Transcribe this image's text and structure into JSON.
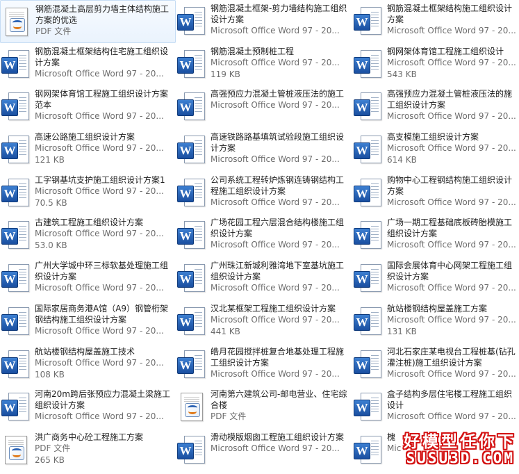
{
  "files": [
    {
      "name": "钢筋混凝土高层剪力墙主体结构施工方案的优选",
      "type": "pdf",
      "meta": [
        "PDF 文件"
      ],
      "selected": true
    },
    {
      "name": "钢筋混凝土框架-剪力墙结构施工组织设计方案",
      "type": "word",
      "meta": [
        "Microsoft Office Word 97 - 20..."
      ]
    },
    {
      "name": "钢筋混凝土框架结构施工组织设计方案",
      "type": "word",
      "meta": [
        "Microsoft Office Word 97 - 20..."
      ]
    },
    {
      "name": "钢筋混凝土框架结构住宅施工组织设计方案",
      "type": "word",
      "meta": [
        "Microsoft Office Word 97 - 20..."
      ]
    },
    {
      "name": "钢筋混凝土预制桩工程",
      "type": "word",
      "meta": [
        "Microsoft Office Word 97 - 20...",
        "119 KB"
      ]
    },
    {
      "name": "钢网架体育馆工程施工组织设计",
      "type": "word",
      "meta": [
        "Microsoft Office Word 97 - 20...",
        "543 KB"
      ]
    },
    {
      "name": "钢网架体育馆工程施工组织设计方案范本",
      "type": "word",
      "meta": [
        "Microsoft Office Word 97 - 20..."
      ]
    },
    {
      "name": "高强预应力混凝土管桩液压法的施工",
      "type": "word",
      "meta": [
        "Microsoft Office Word 97 - 20..."
      ]
    },
    {
      "name": "高强预应力混凝土管桩液压法的施工组织设计方案",
      "type": "word",
      "meta": [
        "Microsoft Office Word 97 - 20..."
      ]
    },
    {
      "name": "高速公路施工组织设计方案",
      "type": "word",
      "meta": [
        "Microsoft Office Word 97 - 20...",
        "121 KB"
      ]
    },
    {
      "name": "高速铁路路基填筑试验段施工组织设计方案",
      "type": "word",
      "meta": [
        "Microsoft Office Word 97 - 20..."
      ]
    },
    {
      "name": "高支模施工组织设计方案",
      "type": "word",
      "meta": [
        "Microsoft Office Word 97 - 20...",
        "614 KB"
      ]
    },
    {
      "name": "工字钢基坑支护施工组织设计方案1",
      "type": "word",
      "meta": [
        "Microsoft Office Word 97 - 20...",
        "70.5 KB"
      ]
    },
    {
      "name": "公司系统工程转炉炼钢连铸钢结构工程施工组织设计方案",
      "type": "word",
      "meta": [
        "Microsoft Office Word 97 - 20..."
      ]
    },
    {
      "name": "购物中心工程钢结构施工组织设计方案",
      "type": "word",
      "meta": [
        "Microsoft Office Word 97 - 20..."
      ]
    },
    {
      "name": "古建筑工程施工组织设计方案",
      "type": "word",
      "meta": [
        "Microsoft Office Word 97 - 20...",
        "53.0 KB"
      ]
    },
    {
      "name": "广场花园工程六层混合结构楼施工组织设计方案",
      "type": "word",
      "meta": [
        "Microsoft Office Word 97 - 20..."
      ]
    },
    {
      "name": "广场一期工程基础底板砖胎模施工组织设计方案",
      "type": "word",
      "meta": [
        "Microsoft Office Word 97 - 20..."
      ]
    },
    {
      "name": "广州大学城中环三标软基处理施工组织设计方案",
      "type": "word",
      "meta": [
        "Microsoft Office Word 97 - 20..."
      ]
    },
    {
      "name": "广州珠江新城利雅湾地下室基坑施工组织设计方案",
      "type": "word",
      "meta": [
        "Microsoft Office Word 97 - 20..."
      ]
    },
    {
      "name": "国际会展体育中心网架工程施工组织设计方案",
      "type": "word",
      "meta": [
        "Microsoft Office Word 97 - 20..."
      ]
    },
    {
      "name": "国际家居商务港A馆（A9）钢管桁架钢结构施工组织设计方案",
      "type": "word",
      "meta": [
        "Microsoft Office Word 97 - 20..."
      ]
    },
    {
      "name": "汉北某框架工程施工组织设计方案",
      "type": "word",
      "meta": [
        "Microsoft Office Word 97 - 20...",
        "441 KB"
      ]
    },
    {
      "name": "航站楼钢结构屋盖施工方案",
      "type": "word",
      "meta": [
        "Microsoft Office Word 97 - 20...",
        "131 KB"
      ]
    },
    {
      "name": "航站楼钢结构屋盖施工技术",
      "type": "word",
      "meta": [
        "Microsoft Office Word 97 - 20...",
        "108 KB"
      ]
    },
    {
      "name": "皓月花园搅拌桩复合地基处理工程施工组织设计方案",
      "type": "word",
      "meta": [
        "Microsoft Office Word 97 - 20..."
      ]
    },
    {
      "name": "河北石家庄某电视台工程桩基(钻孔灌注桩)施工组织设计方案",
      "type": "word",
      "meta": [
        "Microsoft Office Word 97 - 20..."
      ]
    },
    {
      "name": "河南20m跨后张预应力混凝土梁施工组织设计方案",
      "type": "word",
      "meta": [
        "Microsoft Office Word 97 - 20..."
      ]
    },
    {
      "name": "河南第六建筑公司-邮电营业、住宅综合楼",
      "type": "pdf",
      "meta": [
        "PDF 文件"
      ]
    },
    {
      "name": "盒子结构多层住宅楼工程施工组织设计",
      "type": "word",
      "meta": [
        "Microsoft Office Word 97 - 20..."
      ]
    },
    {
      "name": "洪广商务中心砼工程施工方案",
      "type": "pdf",
      "meta": [
        "PDF 文件",
        "265 KB"
      ]
    },
    {
      "name": "滑动模版烟囱工程施工组织设计方案",
      "type": "word",
      "meta": [
        "Microsoft Office Word 97 - 20..."
      ]
    },
    {
      "name": "槐",
      "type": "word",
      "meta": [
        "Mic"
      ]
    }
  ],
  "icons": {
    "word": "word-document-icon",
    "pdf": "pdf-document-icon"
  },
  "watermark": {
    "slogan": "好模型任你下",
    "site": "SUSU3D.COM",
    "color": "#d41414"
  }
}
